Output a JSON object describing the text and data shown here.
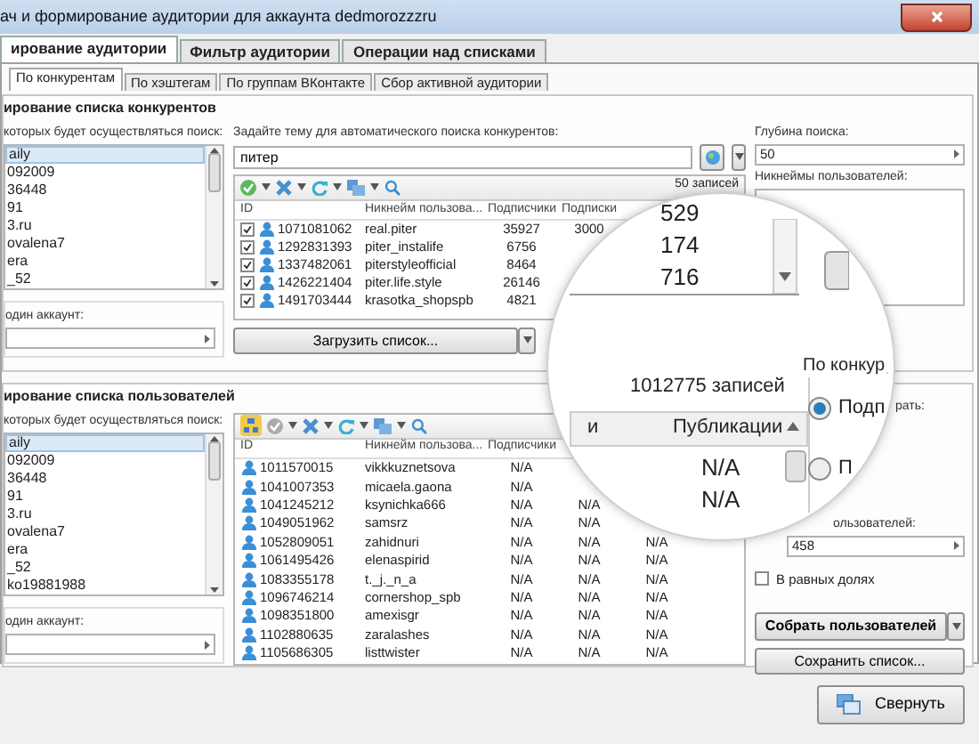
{
  "window": {
    "title": "ач и формирование аудитории для аккаунта dedmorozzzru"
  },
  "main_tabs": [
    {
      "label": "ирование аудитории",
      "selected": true
    },
    {
      "label": "Фильтр аудитории",
      "selected": false
    },
    {
      "label": "Операции над списками",
      "selected": false
    }
  ],
  "sub_tabs": [
    {
      "label": "По конкурентам",
      "selected": true
    },
    {
      "label": "По хэштегам",
      "selected": false
    },
    {
      "label": "По группам ВКонтакте",
      "selected": false
    },
    {
      "label": "Сбор активной аудитории",
      "selected": false
    }
  ],
  "competitors": {
    "title": "ирование списка конкурентов",
    "accounts_label": "которых будет осуществляться поиск:",
    "accounts": [
      {
        "label": "aily",
        "selected": true
      },
      {
        "label": "092009",
        "selected": false
      },
      {
        "label": "36448",
        "selected": false
      },
      {
        "label": "91",
        "selected": false
      },
      {
        "label": "3.ru",
        "selected": false
      },
      {
        "label": "ovalena7",
        "selected": false
      },
      {
        "label": "era",
        "selected": false
      },
      {
        "label": "_52",
        "selected": false
      }
    ],
    "single_account_label": "один аккаунт:",
    "topic_label": "Задайте тему для автоматического поиска конкурентов:",
    "topic_value": "питер",
    "record_count": "50 записей",
    "columns": [
      "ID",
      "Никнейм пользова...",
      "Подписчики",
      "Подписки"
    ],
    "rows": [
      {
        "checked": true,
        "id": "1071081062",
        "nick": "real.piter",
        "followers": "35927",
        "following": "3000"
      },
      {
        "checked": true,
        "id": "1292831393",
        "nick": "piter_instalife",
        "followers": "6756"
      },
      {
        "checked": true,
        "id": "1337482061",
        "nick": "piterstyleofficial",
        "followers": "8464"
      },
      {
        "checked": true,
        "id": "1426221404",
        "nick": "piter.life.style",
        "followers": "26146"
      },
      {
        "checked": true,
        "id": "1491703444",
        "nick": "krasotka_shopspb",
        "followers": "4821"
      }
    ],
    "load_button": "Загрузить список...",
    "depth_label": "Глубина поиска:",
    "depth_value": "50",
    "nicknames_label": "Никнеймы пользователей:"
  },
  "users": {
    "title": "ирование списка пользователей",
    "accounts_label": "которых будет осуществляться поиск:",
    "accounts": [
      {
        "label": "aily",
        "selected": true
      },
      {
        "label": "092009",
        "selected": false
      },
      {
        "label": "36448",
        "selected": false
      },
      {
        "label": "91",
        "selected": false
      },
      {
        "label": "3.ru",
        "selected": false
      },
      {
        "label": "ovalena7",
        "selected": false
      },
      {
        "label": "era",
        "selected": false
      },
      {
        "label": "_52",
        "selected": false
      },
      {
        "label": "ko19881988",
        "selected": false
      }
    ],
    "single_account_label": "один аккаунт:",
    "columns": [
      "ID",
      "Никнейм пользова...",
      "Подписчики"
    ],
    "rows": [
      {
        "id": "1011570015",
        "nick": "vikkkuznetsova",
        "followers": "N/A"
      },
      {
        "id": "1041007353",
        "nick": "micaela.gaona",
        "followers": "N/A"
      },
      {
        "id": "1041245212",
        "nick": "ksynichka666",
        "followers": "N/A",
        "following": "N/A"
      },
      {
        "id": "1049051962",
        "nick": "samsrz",
        "followers": "N/A",
        "following": "N/A"
      },
      {
        "id": "1052809051",
        "nick": "zahidnuri",
        "followers": "N/A",
        "following": "N/A",
        "posts": "N/A"
      },
      {
        "id": "1061495426",
        "nick": "elenaspirid",
        "followers": "N/A",
        "following": "N/A",
        "posts": "N/A"
      },
      {
        "id": "1083355178",
        "nick": "t._j._n_a",
        "followers": "N/A",
        "following": "N/A",
        "posts": "N/A"
      },
      {
        "id": "1096746214",
        "nick": "cornershop_spb",
        "followers": "N/A",
        "following": "N/A",
        "posts": "N/A"
      },
      {
        "id": "1098351800",
        "nick": "amexisgr",
        "followers": "N/A",
        "following": "N/A",
        "posts": "N/A"
      },
      {
        "id": "1102880635",
        "nick": "zaralashes",
        "followers": "N/A",
        "following": "N/A",
        "posts": "N/A"
      },
      {
        "id": "1105686305",
        "nick": "listtwister",
        "followers": "N/A",
        "following": "N/A",
        "posts": "N/A"
      }
    ],
    "users_label": "ользователей:",
    "users_value": "458",
    "equal_shares": {
      "label": "В равных долях",
      "checked": false
    },
    "collect_button": "Собрать пользователей",
    "save_button": "Сохранить список..."
  },
  "magnifier": {
    "values": [
      "529",
      "174",
      "716"
    ],
    "record_count": "1012775 записей",
    "column_cut": "и",
    "column": "Публикации",
    "cells": [
      "N/A",
      "N/A"
    ],
    "group_title": "По конкур",
    "group_label": "рать:",
    "radios": [
      {
        "label": "Подп",
        "selected": true
      },
      {
        "label": "П",
        "selected": false
      }
    ]
  },
  "minimize_button": "Свернуть"
}
